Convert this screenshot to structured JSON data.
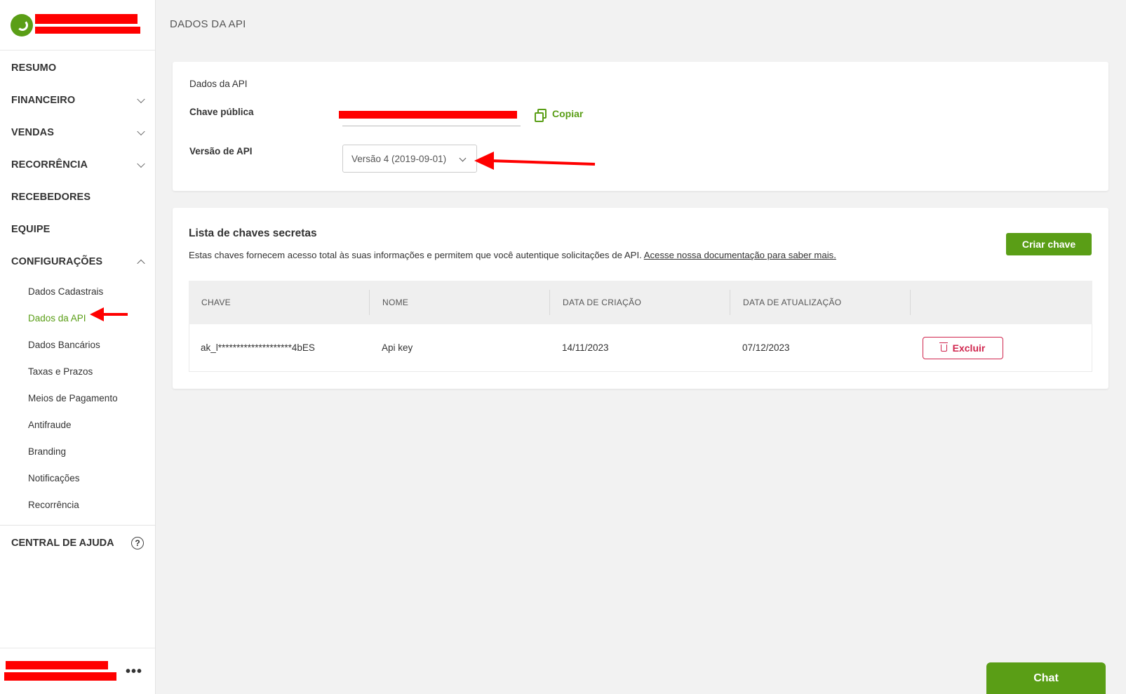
{
  "page": {
    "title": "DADOS DA API"
  },
  "sidebar": {
    "items": [
      {
        "label": "RESUMO"
      },
      {
        "label": "FINANCEIRO"
      },
      {
        "label": "VENDAS"
      },
      {
        "label": "RECORRÊNCIA"
      },
      {
        "label": "RECEBEDORES"
      },
      {
        "label": "EQUIPE"
      },
      {
        "label": "CONFIGURAÇÕES"
      }
    ],
    "sub_items": [
      {
        "label": "Dados Cadastrais"
      },
      {
        "label": "Dados da API"
      },
      {
        "label": "Dados Bancários"
      },
      {
        "label": "Taxas e Prazos"
      },
      {
        "label": "Meios de Pagamento"
      },
      {
        "label": "Antifraude"
      },
      {
        "label": "Branding"
      },
      {
        "label": "Notificações"
      },
      {
        "label": "Recorrência"
      }
    ],
    "help_label": "CENTRAL DE AJUDA",
    "help_icon": "?",
    "more_label": "•••"
  },
  "api_card": {
    "heading": "Dados da API",
    "public_key_label": "Chave pública",
    "copy_label": "Copiar",
    "version_label": "Versão de API",
    "version_value": "Versão 4 (2019-09-01)"
  },
  "secret_keys": {
    "title": "Lista de chaves secretas",
    "description": "Estas chaves fornecem acesso total às suas informações e permitem que você autentique solicitações de API. ",
    "doc_link": "Acesse nossa documentação para saber mais.",
    "create_label": "Criar chave",
    "columns": [
      "CHAVE",
      "NOME",
      "DATA DE CRIAÇÃO",
      "DATA DE ATUALIZAÇÃO"
    ],
    "rows": [
      {
        "key": "ak_l********************4bES",
        "name": "Api key",
        "created": "14/11/2023",
        "updated": "07/12/2023",
        "action": "Excluir"
      }
    ]
  },
  "chat": {
    "label": "Chat"
  },
  "colors": {
    "brand": "#5a9e16",
    "danger": "#d0264e",
    "annotation": "#ff0000"
  }
}
